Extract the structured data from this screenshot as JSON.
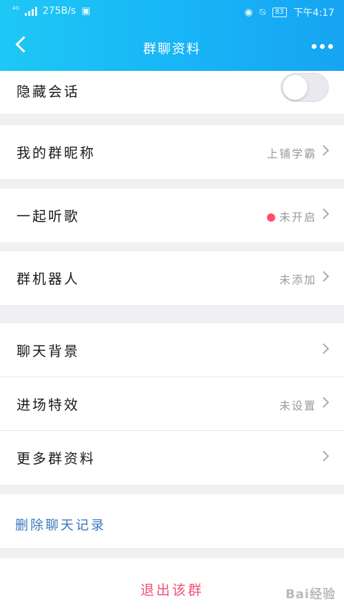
{
  "status": {
    "net": "4G",
    "speed": "275B/s",
    "battery": "83",
    "time": "下午4:17"
  },
  "nav": {
    "title": "群聊资料"
  },
  "hidden_chat": {
    "label": "隐藏会话",
    "enabled": false
  },
  "nickname": {
    "label": "我的群昵称",
    "value": "上铺学霸"
  },
  "listen": {
    "label": "一起听歌",
    "value": "未开启",
    "dot_color": "#ff4f6b"
  },
  "robot": {
    "label": "群机器人",
    "value": "未添加"
  },
  "settings": [
    {
      "label": "聊天背景",
      "value": ""
    },
    {
      "label": "进场特效",
      "value": "未设置"
    },
    {
      "label": "更多群资料",
      "value": ""
    }
  ],
  "delete_history": "删除聊天记录",
  "exit_group": "退出该群",
  "watermark": "Bai经验"
}
